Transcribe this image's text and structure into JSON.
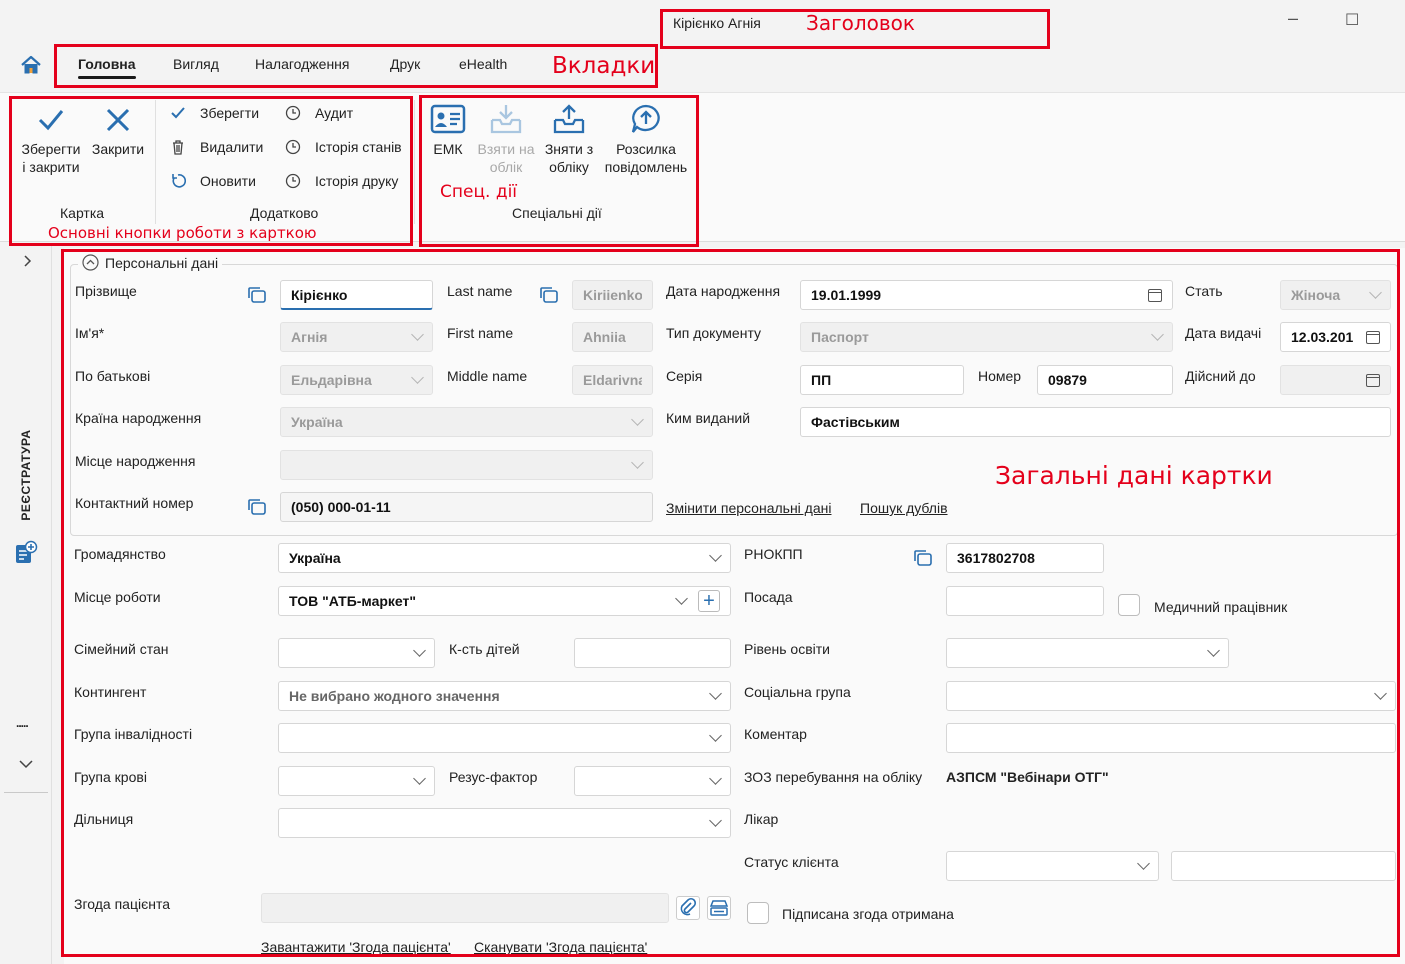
{
  "window": {
    "title": "Кірієнко Агнія",
    "minimize_glyph": "–",
    "maximize_glyph": "☐"
  },
  "annotations": {
    "title": "Заголовок",
    "tabs": "Вкладки",
    "main_buttons": "Основні кнопки роботи з карткою",
    "special": "Спец. дії",
    "general": "Загальні дані картки",
    "color": "#e4001b"
  },
  "tabs": [
    "Головна",
    "Вигляд",
    "Налагодження",
    "Друк",
    "eHealth"
  ],
  "ribbon": {
    "karta": {
      "save_close": "Зберегти\nі закрити",
      "close": "Закрити",
      "group_label": "Картка"
    },
    "extra": {
      "save": "Зберегти",
      "delete": "Видалити",
      "refresh": "Оновити",
      "audit": "Аудит",
      "state_history": "Історія станів",
      "print_history": "Історія друку",
      "group_label": "Додатково"
    },
    "special": {
      "emk": "ЕМК",
      "take": "Взяти на\nоблік",
      "remove": "Зняти з\nобліку",
      "mailing": "Розсилка\nповідомлень",
      "group_label": "Спеціальні дії"
    }
  },
  "sidebar": {
    "label": "РЕЄСТРАТУРА",
    "more": "....."
  },
  "personal": {
    "header": "Персональні дані",
    "surname_label": "Прізвище",
    "surname": "Кірієнко",
    "name_label": "Ім'я*",
    "name": "Агнія",
    "patronymic_label": "По батькові",
    "patronymic": "Ельдарівна",
    "birth_country_label": "Країна народження",
    "birth_country": "Україна",
    "birth_place_label": "Місце народження",
    "birth_place": "",
    "phone_label": "Контактний номер",
    "phone": "(050) 000-01-11",
    "last_name_label": "Last name",
    "last_name": "Kiriienko",
    "first_name_label": "First name",
    "first_name": "Ahniia",
    "middle_name_label": "Middle name",
    "middle_name": "Eldarivna",
    "birth_date_label": "Дата народження",
    "birth_date": "19.01.1999",
    "doc_type_label": "Тип документу",
    "doc_type": "Паспорт",
    "series_label": "Серія",
    "series": "ПП",
    "number_label": "Номер",
    "number": "09879",
    "issued_by_label": "Ким виданий",
    "issued_by": "Фастівським",
    "sex_label": "Стать",
    "sex": "Жіноча",
    "issue_date_label": "Дата видачі",
    "issue_date": "12.03.201",
    "valid_until_label": "Дійсний до",
    "valid_until": "",
    "change_link": "Змінити персональні дані",
    "dup_link": "Пошук дублів"
  },
  "general": {
    "citizenship_label": "Громадянство",
    "citizenship": "Україна",
    "work_label": "Місце роботи",
    "work": "ТОВ \"АТБ-маркет\"",
    "marital_label": "Сімейний стан",
    "marital": "",
    "children_label": "К-сть дітей",
    "children": "",
    "contingent_label": "Контингент",
    "contingent": "Не вибрано жодного значення",
    "disability_label": "Група інвалідності",
    "disability": "",
    "blood_label": "Група крові",
    "blood": "",
    "rh_label": "Резус-фактор",
    "rh": "",
    "district_label": "Дільниця",
    "district": "",
    "consent_label": "Згода пацієнта",
    "consent": "",
    "upload_link": "Завантажити 'Згода пацієнта'",
    "scan_link": "Сканувати 'Згода пацієнта'",
    "rnokpp_label": "РНОКПП",
    "rnokpp": "3617802708",
    "position_label": "Посада",
    "position": "",
    "medical_worker": "Медичний працівник",
    "education_label": "Рівень освіти",
    "education": "",
    "social_label": "Соціальна група",
    "social": "",
    "comment_label": "Коментар",
    "comment": "",
    "zoz_label": "ЗОЗ перебування на обліку",
    "zoz": "АЗПСМ \"Вебінари ОТГ\"",
    "doctor_label": "Лікар",
    "status_label": "Статус клієнта",
    "status": "",
    "status_extra": "",
    "signed_consent": "Підписана згода отримана"
  }
}
